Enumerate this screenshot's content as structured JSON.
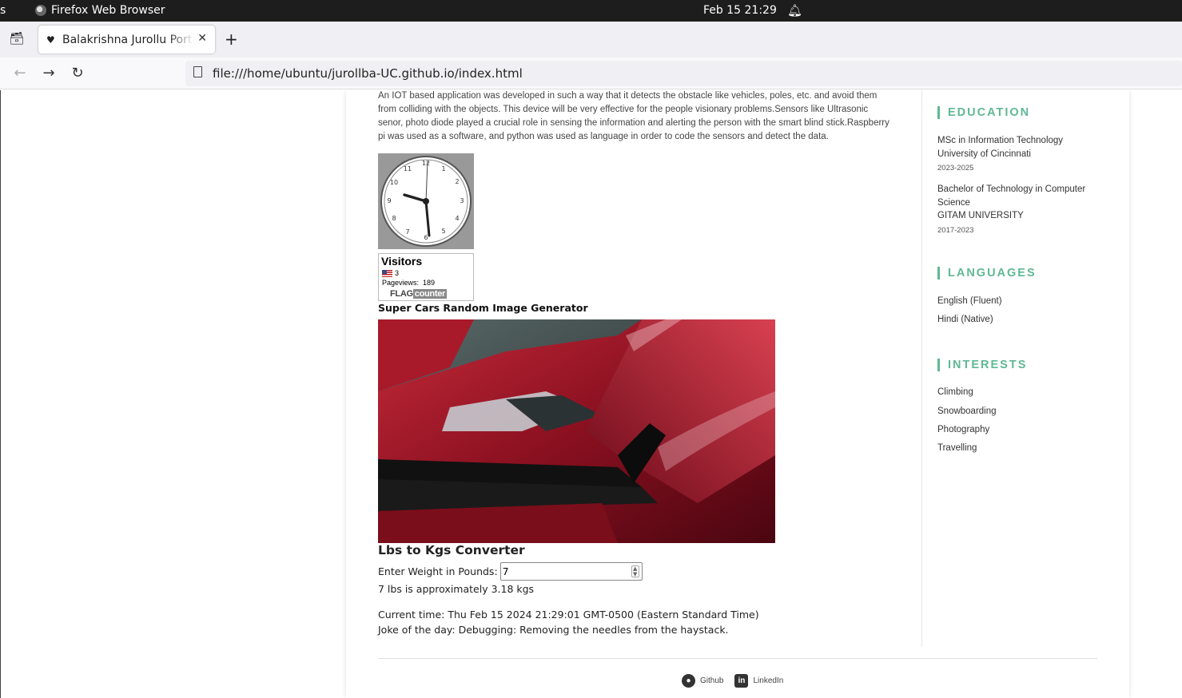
{
  "system_bar": {
    "left_fragment": "s",
    "app_name": "Firefox Web Browser",
    "datetime": "Feb 15  21:29"
  },
  "browser": {
    "tab_title": "Balakrishna Jurollu Portfolio",
    "url": "file:///home/ubuntu/jurollba-UC.github.io/index.html"
  },
  "main": {
    "project_description": "An IOT based application was developed in such a way that it detects the obstacle like vehicles, poles, etc. and avoid them from colliding with the objects. This device will be very effective for the people visionary problems.Sensors like Ultrasonic senor, photo diode played a crucial role in sensing the information and alerting the person with the smart blind stick.Raspberry pi was used as a software, and python was used as language in order to code the sensors and detect the data.",
    "clock_numbers": [
      "12",
      "1",
      "2",
      "3",
      "4",
      "5",
      "6",
      "7",
      "8",
      "9",
      "10",
      "11"
    ],
    "flag_counter": {
      "title": "Visitors",
      "us_count": "3",
      "pageviews_label": "Pageviews:",
      "pageviews_value": "189",
      "logo_flag": "FLAG",
      "logo_counter": "counter"
    },
    "supercars_title": "Super Cars Random Image Generator",
    "converter": {
      "title": "Lbs to Kgs Converter",
      "label": "Enter Weight in Pounds:",
      "value": "7",
      "result": "7 lbs is approximately 3.18 kgs"
    },
    "current_time": "Current time: Thu Feb 15 2024 21:29:01 GMT-0500 (Eastern Standard Time)",
    "joke": "Joke of the day: Debugging: Removing the needles from the haystack."
  },
  "sidebar": {
    "education_heading": "EDUCATION",
    "education": [
      {
        "degree": "MSc in Information Technology",
        "school": "University of Cincinnati",
        "years": "2023-2025"
      },
      {
        "degree_line1": "Bachelor of Technology in Computer",
        "degree_line2": "Science",
        "school": "GITAM UNIVERSITY",
        "years": "2017-2023"
      }
    ],
    "languages_heading": "LANGUAGES",
    "languages": [
      "English (Fluent)",
      "Hindi (Native)"
    ],
    "interests_heading": "INTERESTS",
    "interests": [
      "Climbing",
      "Snowboarding",
      "Photography",
      "Travelling"
    ]
  },
  "footer": {
    "github_label": "Github",
    "linkedin_label": "LinkedIn"
  },
  "colors": {
    "accent": "#5fb894",
    "system_bar": "#1d1d1d"
  }
}
